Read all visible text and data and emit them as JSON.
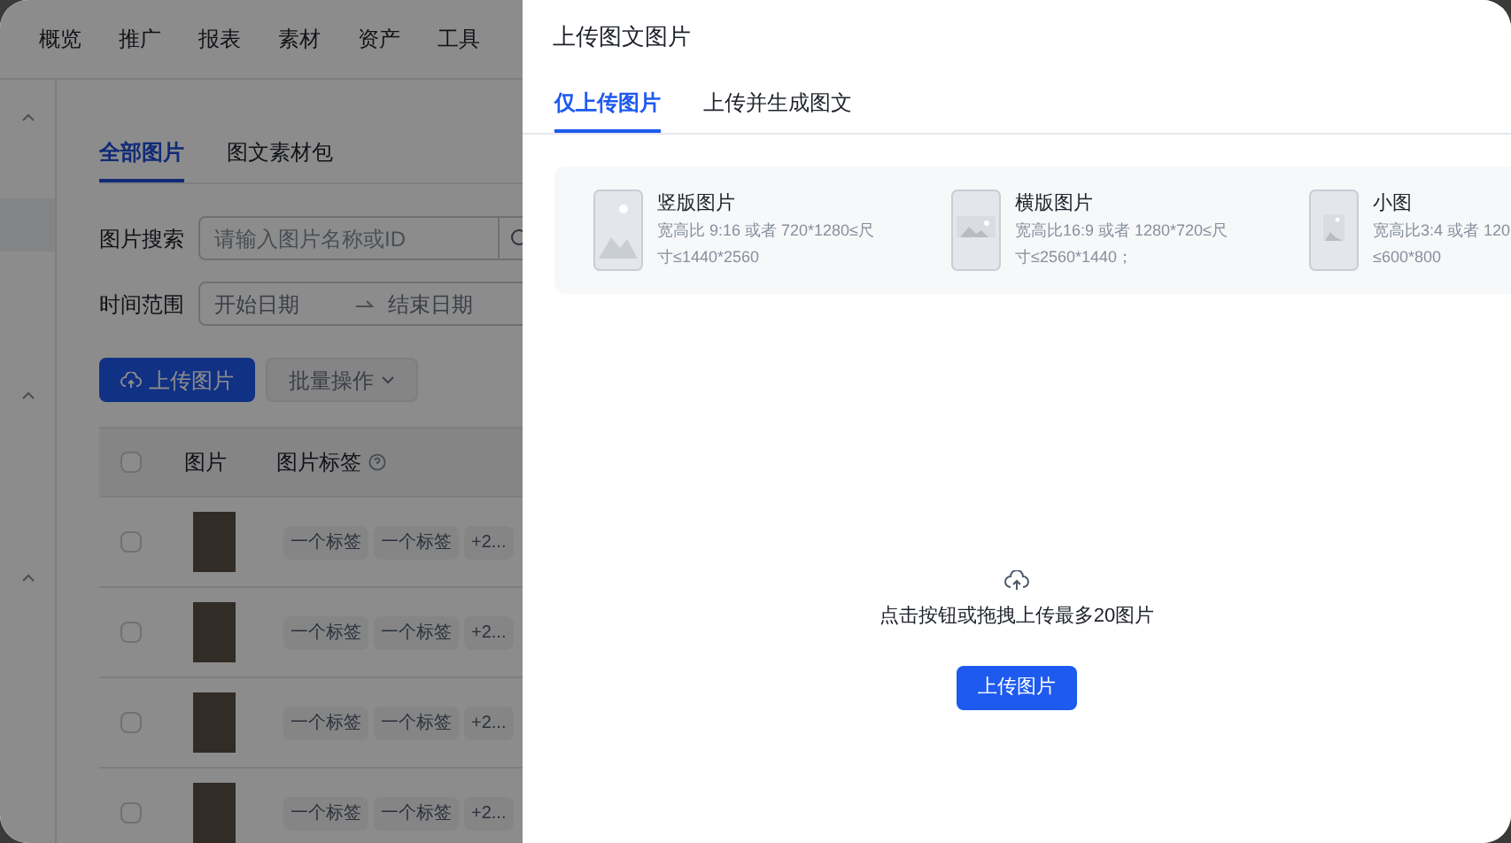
{
  "top_nav": [
    {
      "label": "概览"
    },
    {
      "label": "推广"
    },
    {
      "label": "报表"
    },
    {
      "label": "素材"
    },
    {
      "label": "资产"
    },
    {
      "label": "工具"
    }
  ],
  "page_tabs": [
    {
      "label": "全部图片",
      "selected": true
    },
    {
      "label": "图文素材包",
      "selected": false
    }
  ],
  "search": {
    "label": "图片搜索",
    "placeholder": "请输入图片名称或ID"
  },
  "date_range": {
    "label": "时间范围",
    "start_placeholder": "开始日期",
    "end_placeholder": "结束日期"
  },
  "upload_button": "上传图片",
  "batch_button": {
    "label": "批量操作",
    "disabled": true
  },
  "table": {
    "header_checked": false,
    "columns": [
      "图片",
      "图片标签"
    ],
    "rows": [
      {
        "checked": false,
        "tags": [
          "一个标签",
          "一个标签",
          "+2..."
        ]
      },
      {
        "checked": false,
        "tags": [
          "一个标签",
          "一个标签",
          "+2..."
        ]
      },
      {
        "checked": false,
        "tags": [
          "一个标签",
          "一个标签",
          "+2..."
        ]
      },
      {
        "checked": false,
        "tags": [
          "一个标签",
          "一个标签",
          "+2..."
        ]
      }
    ]
  },
  "drawer": {
    "title": "上传图文图片",
    "tabs": [
      {
        "label": "仅上传图片",
        "selected": true
      },
      {
        "label": "上传并生成图文",
        "selected": false
      }
    ],
    "specs": [
      {
        "kind": "portrait",
        "title": "竖版图片",
        "lines": [
          "宽高比 9:16 或者 720*1280≤尺",
          "寸≤1440*2560"
        ]
      },
      {
        "kind": "landscape",
        "title": "横版图片",
        "lines": [
          "宽高比16:9 或者 1280*720≤尺",
          "寸≤2560*1440；"
        ]
      },
      {
        "kind": "small",
        "title": "小图",
        "lines": [
          "宽高比3:4 或者 120",
          "≤600*800"
        ]
      }
    ],
    "upload_hint": "点击按钮或拖拽上传最多20图片",
    "upload_button": "上传图片"
  }
}
